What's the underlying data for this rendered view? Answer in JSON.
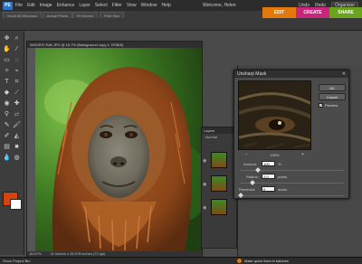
{
  "app": {
    "logo": "PE",
    "menu": [
      "File",
      "Edit",
      "Image",
      "Enhance",
      "Layer",
      "Select",
      "Filter",
      "View",
      "Window",
      "Help"
    ],
    "welcome": "Welcome, Helen",
    "undo": "Undo",
    "redo": "Redo",
    "organizer": "Organizer"
  },
  "shortcut_tabs": [
    "Scroll All Windows",
    "Actual Pixels",
    "Fit Screen",
    "Print Size"
  ],
  "mode_tabs": {
    "edit": "EDIT",
    "create": "CREATE",
    "share": "SHARE"
  },
  "document": {
    "title": "IMG0970 Edit.JPG @ 16.7% (Background copy 4, RGB/8)",
    "zoom": "16.67%",
    "info": "21 inches x 15.578 inches (72 ppi)"
  },
  "layers_panel": {
    "title": "Layers",
    "blend": "Normal"
  },
  "unsharp_mask": {
    "title": "Unsharp Mask",
    "ok": "OK",
    "cancel": "Cancel",
    "preview_label": "Preview",
    "preview_checked": true,
    "zoom_out": "−",
    "zoom_level": "100%",
    "zoom_in": "+",
    "amount_label": "Amount:",
    "amount_value": "100",
    "amount_unit": "%",
    "radius_label": "Radius:",
    "radius_value": "2.0",
    "radius_unit": "pixels",
    "threshold_label": "Threshold:",
    "threshold_value": "0",
    "threshold_unit": "levels"
  },
  "bottom": {
    "left": "Show Project Bin",
    "right": "Make quick fixes in batches"
  },
  "colors": {
    "foreground": "#d6440e",
    "background": "#ffffff",
    "edit_tab": "#e2780e",
    "create_tab": "#c8267c",
    "share_tab": "#6aa31e"
  }
}
